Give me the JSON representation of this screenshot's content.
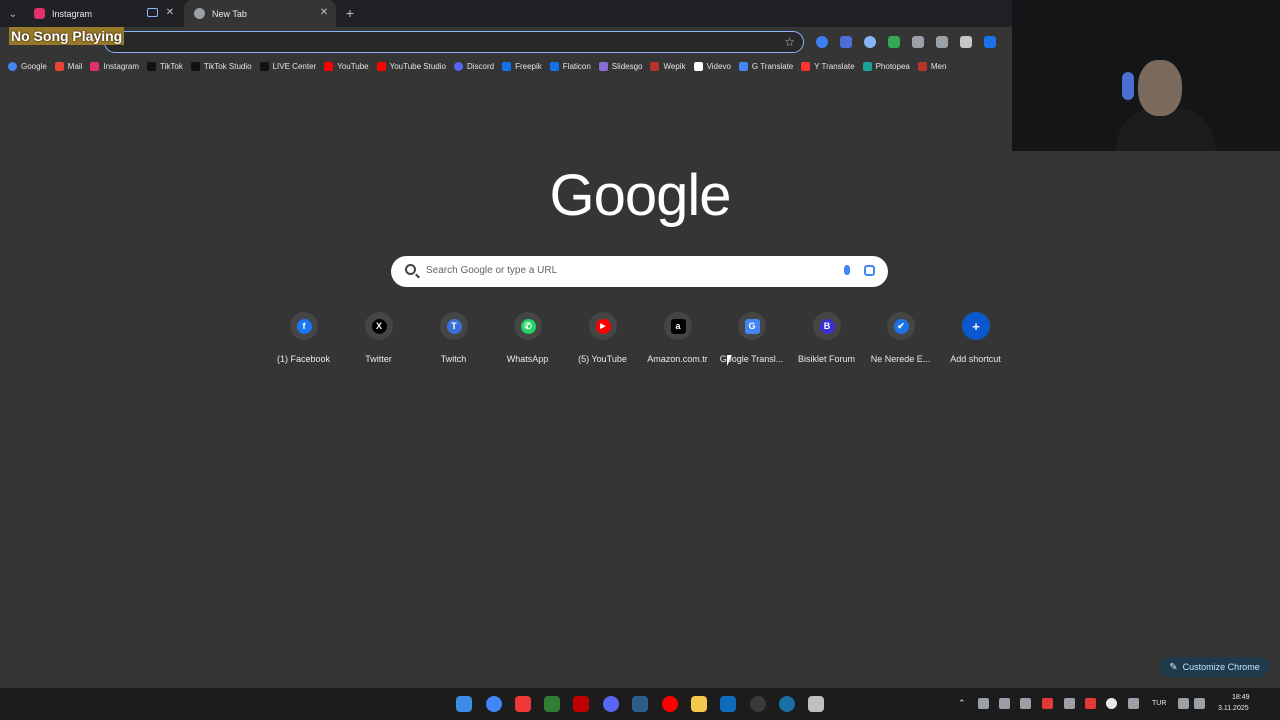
{
  "browser": {
    "tabs": [
      {
        "title": "Instagram",
        "active": false,
        "favicon_color": "#e1306c"
      },
      {
        "title": "New Tab",
        "active": true,
        "favicon_color": "#9aa0a6"
      }
    ],
    "omnibox_value": "",
    "overlay_badge": "No Song Playing"
  },
  "bookmarks": [
    {
      "label": "Google",
      "color": "#4285f4"
    },
    {
      "label": "Mail",
      "color": "#ea4335"
    },
    {
      "label": "Instagram",
      "color": "#e1306c"
    },
    {
      "label": "TikTok",
      "color": "#111111"
    },
    {
      "label": "TikTok Studio",
      "color": "#111111"
    },
    {
      "label": "LIVE Center",
      "color": "#111111"
    },
    {
      "label": "YouTube",
      "color": "#ff0000"
    },
    {
      "label": "YouTube Studio",
      "color": "#ff0000"
    },
    {
      "label": "Discord",
      "color": "#5865f2"
    },
    {
      "label": "Freepik",
      "color": "#1273eb"
    },
    {
      "label": "Flaticon",
      "color": "#1273eb"
    },
    {
      "label": "Slidesgo",
      "color": "#8a6bd4"
    },
    {
      "label": "Wepik",
      "color": "#b8332a"
    },
    {
      "label": "Videvo",
      "color": "#ffffff"
    },
    {
      "label": "G Translate",
      "color": "#4285f4"
    },
    {
      "label": "Y Translate",
      "color": "#ff3333"
    },
    {
      "label": "Photopea",
      "color": "#18a497"
    },
    {
      "label": "Men",
      "color": "#b8332a"
    }
  ],
  "newtab": {
    "logo": "Google",
    "search_placeholder": "Search Google or type a URL",
    "shortcuts": [
      {
        "label": "(1) Facebook",
        "glyph": "f",
        "color": "#1877f2"
      },
      {
        "label": "Twitter",
        "glyph": "X",
        "color": "#000000"
      },
      {
        "label": "Twitch",
        "glyph": "T",
        "color": "#3d6fd9"
      },
      {
        "label": "WhatsApp",
        "glyph": "✆",
        "color": "#25d366"
      },
      {
        "label": "(5) YouTube",
        "glyph": "▶",
        "color": "#ff0000"
      },
      {
        "label": "Amazon.com.tr",
        "glyph": "a",
        "color": "#000000"
      },
      {
        "label": "Google Transl...",
        "glyph": "G",
        "color": "#4285f4"
      },
      {
        "label": "Bisiklet Forum",
        "glyph": "B",
        "color": "#3b2fcf"
      },
      {
        "label": "Ne Nerede E...",
        "glyph": "✔",
        "color": "#1a73e8"
      },
      {
        "label": "Add shortcut",
        "glyph": "+",
        "color": "#0b57d0"
      }
    ],
    "customize_label": "Customize Chrome"
  },
  "taskbar": {
    "language": "TUR",
    "time": "18:49",
    "date": "3.11.2025"
  }
}
